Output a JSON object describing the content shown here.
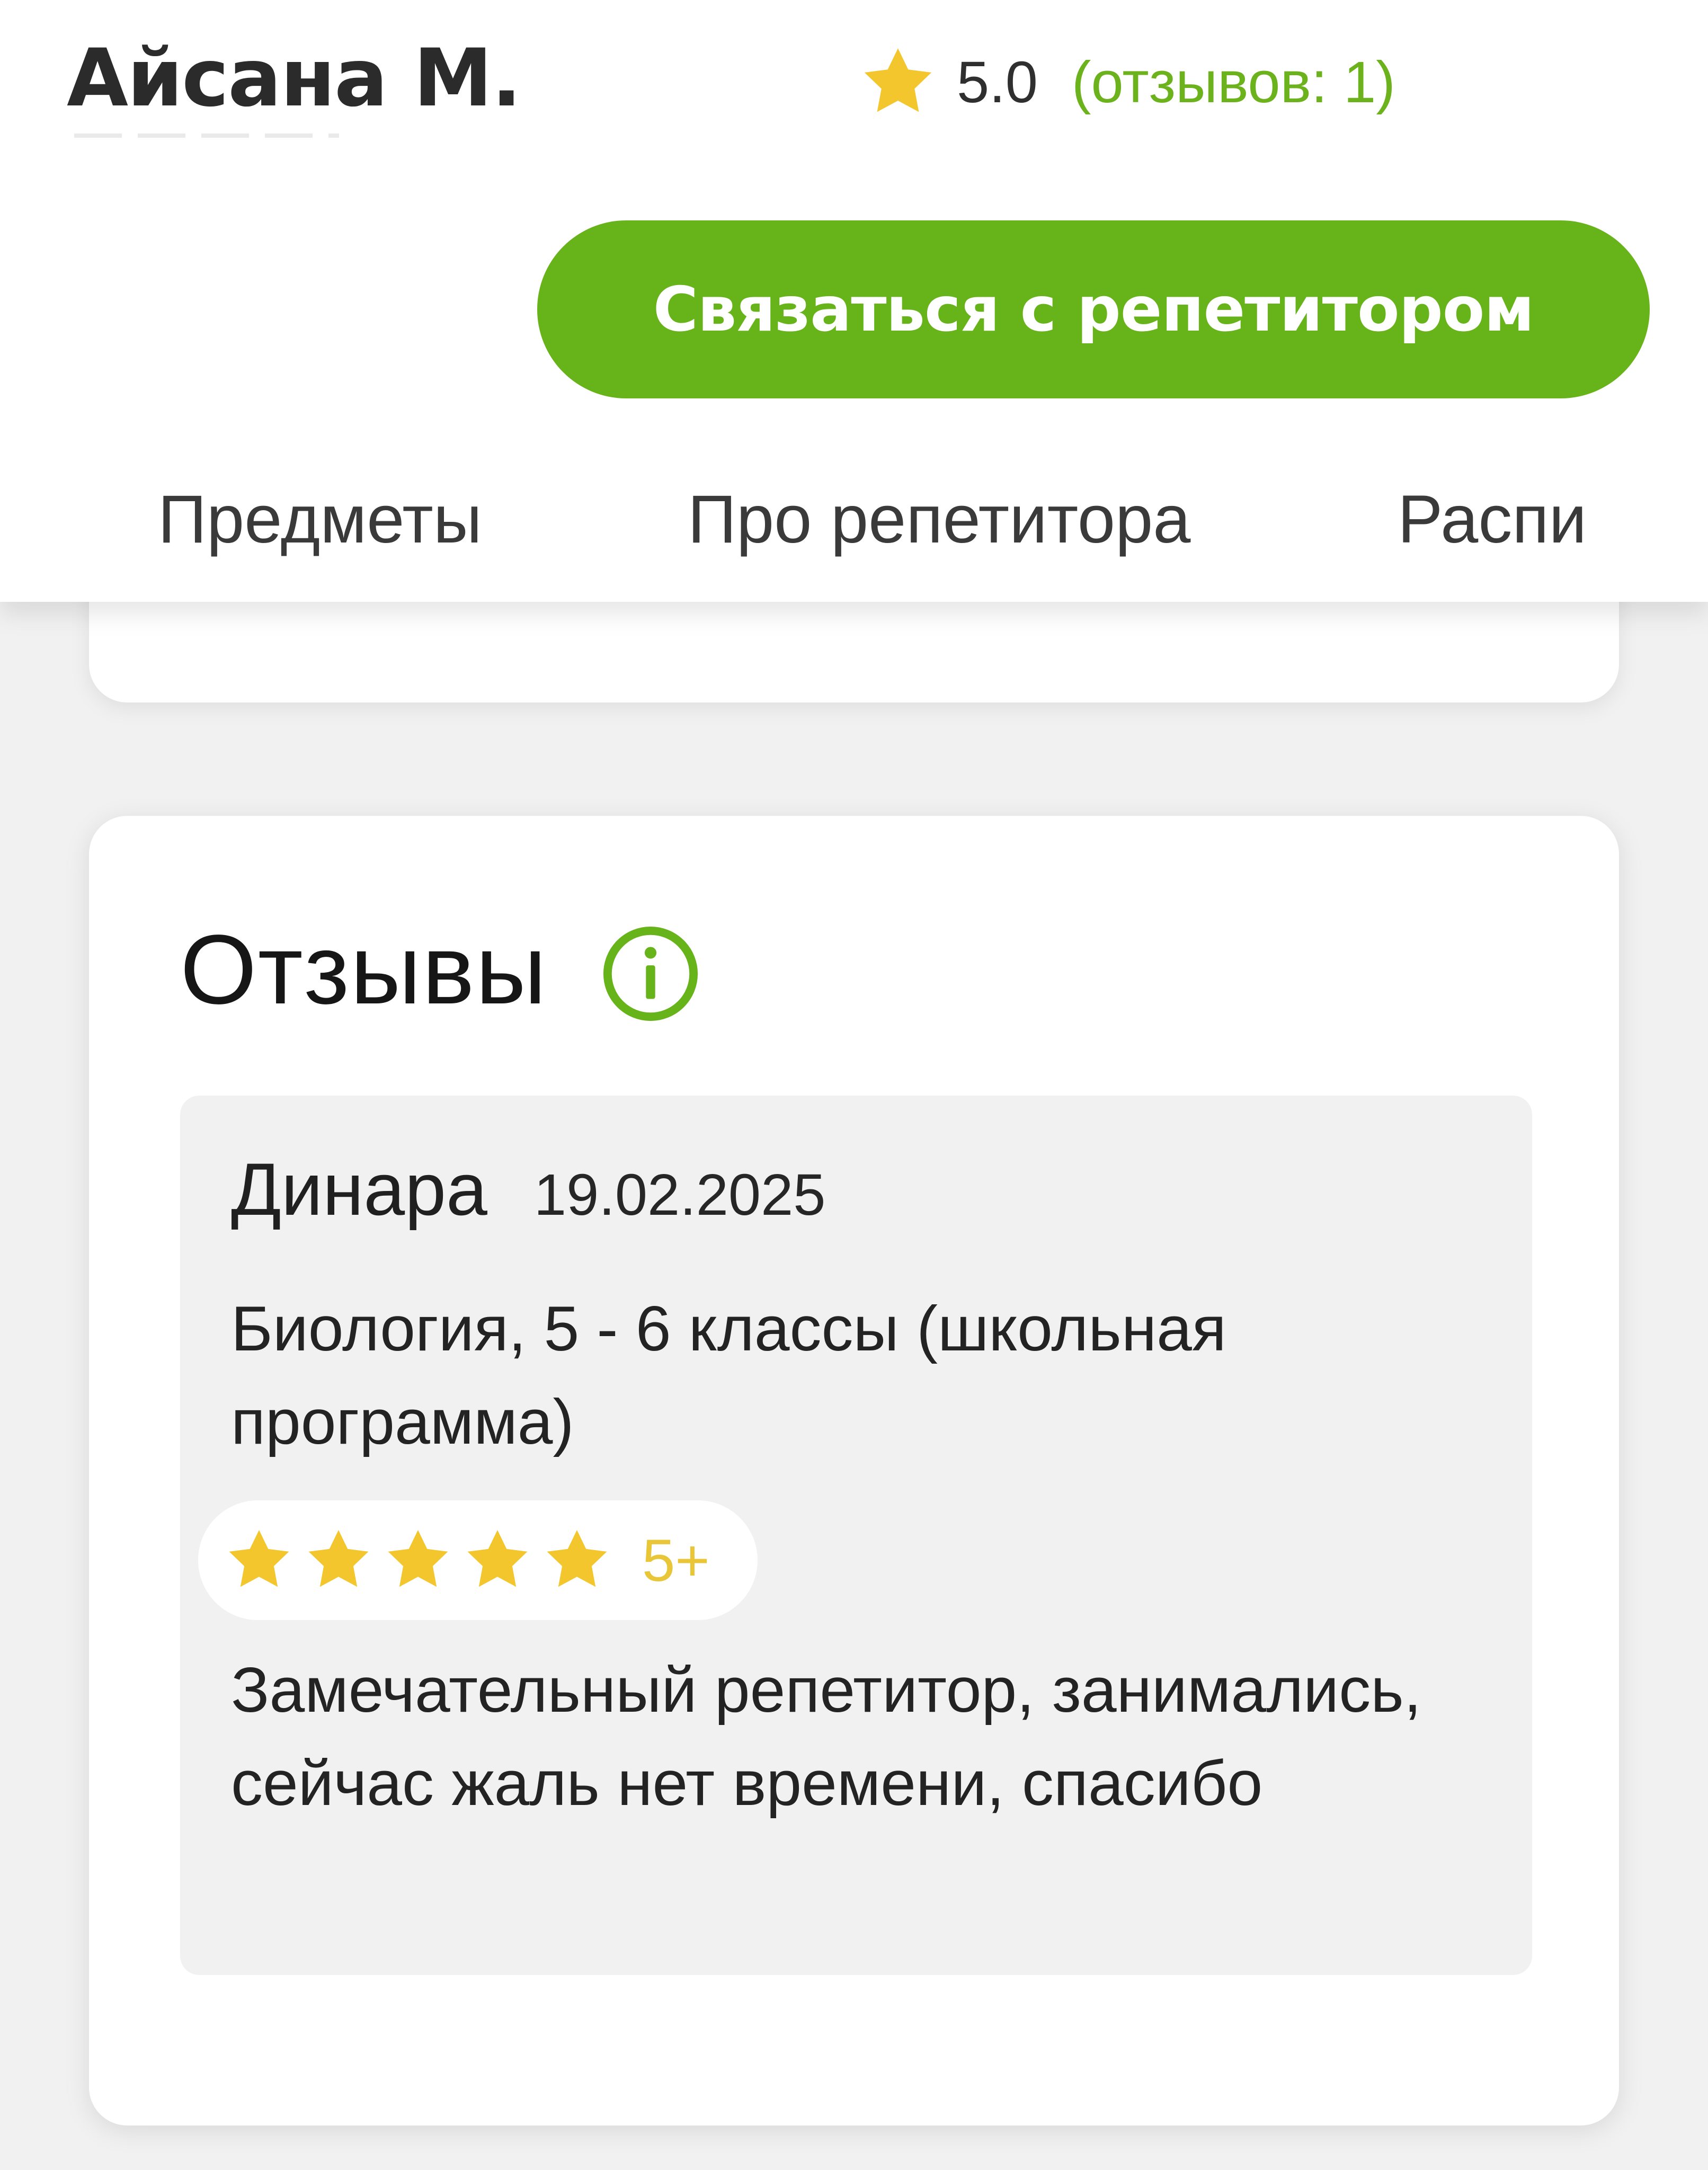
{
  "header": {
    "tutor_name": "Айсана М.",
    "rating_value": "5.0",
    "reviews_count": "(отзывов: 1)",
    "contact_button": "Связаться с репетитором"
  },
  "tabs": [
    {
      "label": "Предметы"
    },
    {
      "label": "Про репетитора"
    },
    {
      "label": "Распи"
    }
  ],
  "reviews": {
    "title": "Отзывы",
    "items": [
      {
        "name": "Динара",
        "date": "19.02.2025",
        "subject": "Биология, 5 - 6 классы (школьная программа)",
        "stars": 5,
        "score_label": "5+",
        "text": "Замечательный репетитор, занимались, сейчас жаль нет времени, спасибо"
      }
    ]
  },
  "colors": {
    "brand_green": "#67b31a",
    "link_green": "#6cb21d",
    "star_gold": "#f2c62c",
    "score_gold": "#e9c638"
  },
  "icons": {
    "rating": "star-icon",
    "info": "info-icon",
    "review_stars": "star-icon"
  }
}
